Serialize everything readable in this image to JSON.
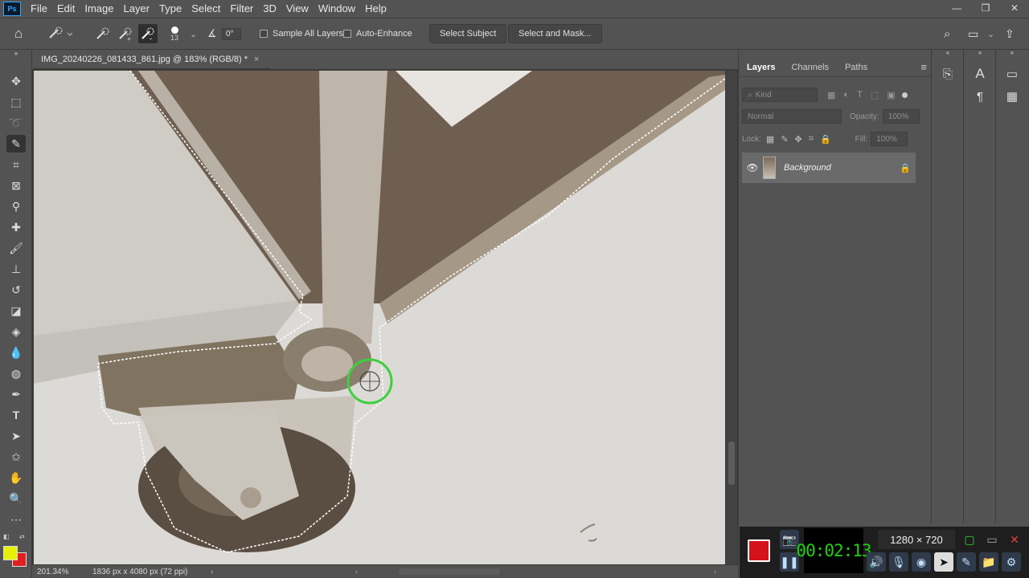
{
  "menubar": {
    "logo": "Ps",
    "items": [
      "File",
      "Edit",
      "Image",
      "Layer",
      "Type",
      "Select",
      "Filter",
      "3D",
      "View",
      "Window",
      "Help"
    ]
  },
  "options": {
    "brush_size": "13",
    "angle": "0°",
    "sample_all_layers": "Sample All Layers",
    "auto_enhance": "Auto-Enhance",
    "select_subject": "Select Subject",
    "select_and_mask": "Select and Mask..."
  },
  "document": {
    "tab_title": "IMG_20240226_081433_861.jpg @ 183% (RGB/8) *",
    "close": "×"
  },
  "status": {
    "zoom": "201.34%",
    "dims": "1836 px x 4080 px (72 ppi)"
  },
  "layers_panel": {
    "tabs": [
      "Layers",
      "Channels",
      "Paths"
    ],
    "kind_placeholder": "Kind",
    "blend_mode": "Normal",
    "opacity_label": "Opacity:",
    "opacity_value": "100%",
    "lock_label": "Lock:",
    "fill_label": "Fill:",
    "fill_value": "100%",
    "layer_name": "Background"
  },
  "recorder": {
    "time": "00:02:13",
    "resolution": "1280 × 720"
  },
  "colors": {
    "foreground": "#e6f000",
    "background": "#e02020",
    "selection_cursor": "#3cd03c"
  }
}
